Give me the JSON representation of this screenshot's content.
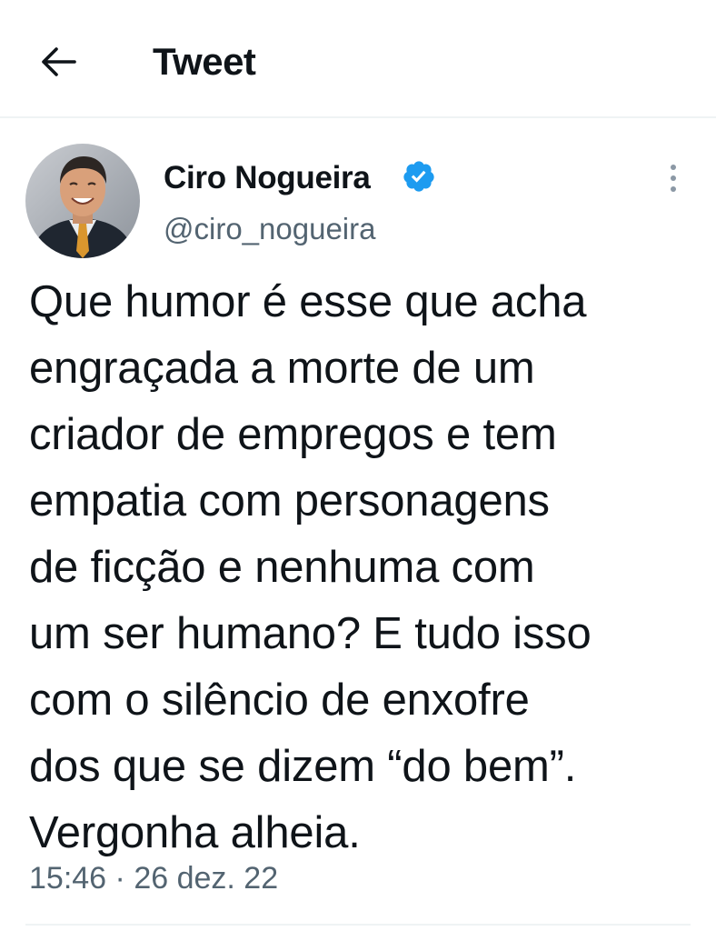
{
  "header": {
    "back_icon": "arrow-left-icon",
    "title": "Tweet"
  },
  "author": {
    "name": "Ciro Nogueira",
    "handle": "@ciro_nogueira",
    "verified_icon": "verified-badge-icon",
    "verified_color": "#1d9bf0"
  },
  "tweet": {
    "text": "Que humor é esse que acha\nengraçada a morte de um\ncriador de empregos e tem\nempatia com personagens\nde ficção e nenhuma com\num ser humano? E tudo isso\ncom o silêncio de enxofre\ndos que se dizem “do bem”.\nVergonha alheia.",
    "time": "15:46",
    "separator": "·",
    "date": "26 dez. 22"
  },
  "more_icon": "more-vertical-icon",
  "colors": {
    "text_primary": "#0f1419",
    "text_secondary": "#536471",
    "divider": "#eff3f4"
  }
}
